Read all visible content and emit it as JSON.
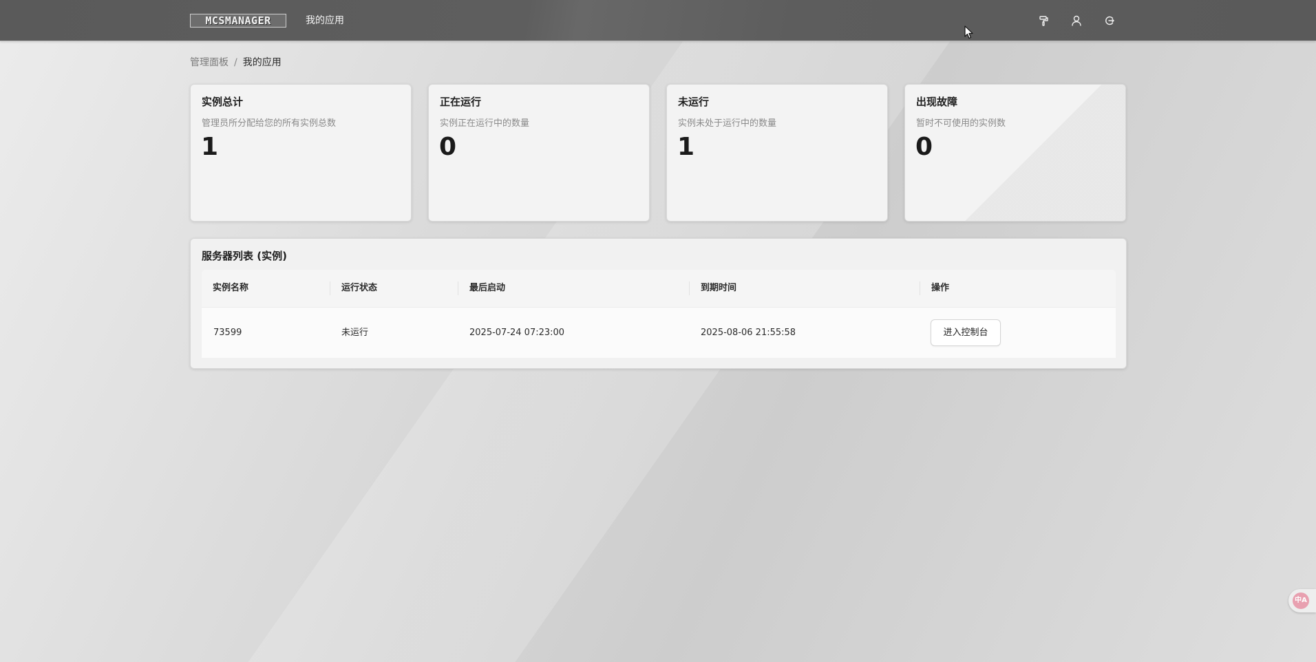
{
  "header": {
    "logo_text": "MCSMANAGER",
    "nav_apps": "我的应用",
    "icons": [
      "paint-roller-icon",
      "user-icon",
      "logout-icon"
    ]
  },
  "breadcrumb": {
    "root": "管理面板",
    "separator": "/",
    "current": "我的应用"
  },
  "stats": [
    {
      "title": "实例总计",
      "subtitle": "管理员所分配给您的所有实例总数",
      "value": "1"
    },
    {
      "title": "正在运行",
      "subtitle": "实例正在运行中的数量",
      "value": "0"
    },
    {
      "title": "未运行",
      "subtitle": "实例未处于运行中的数量",
      "value": "1"
    },
    {
      "title": "出现故障",
      "subtitle": "暂时不可使用的实例数",
      "value": "0"
    }
  ],
  "instances_panel": {
    "title": "服务器列表 (实例)",
    "columns": [
      "实例名称",
      "运行状态",
      "最后启动",
      "到期时间",
      "操作"
    ],
    "rows": [
      {
        "name": "73599",
        "status": "未运行",
        "last_start": "2025-07-24 07:23:00",
        "expire": "2025-08-06 21:55:58",
        "action_label": "进入控制台"
      }
    ]
  },
  "lang_button": {
    "icon": "translate-icon",
    "label": "中A"
  }
}
